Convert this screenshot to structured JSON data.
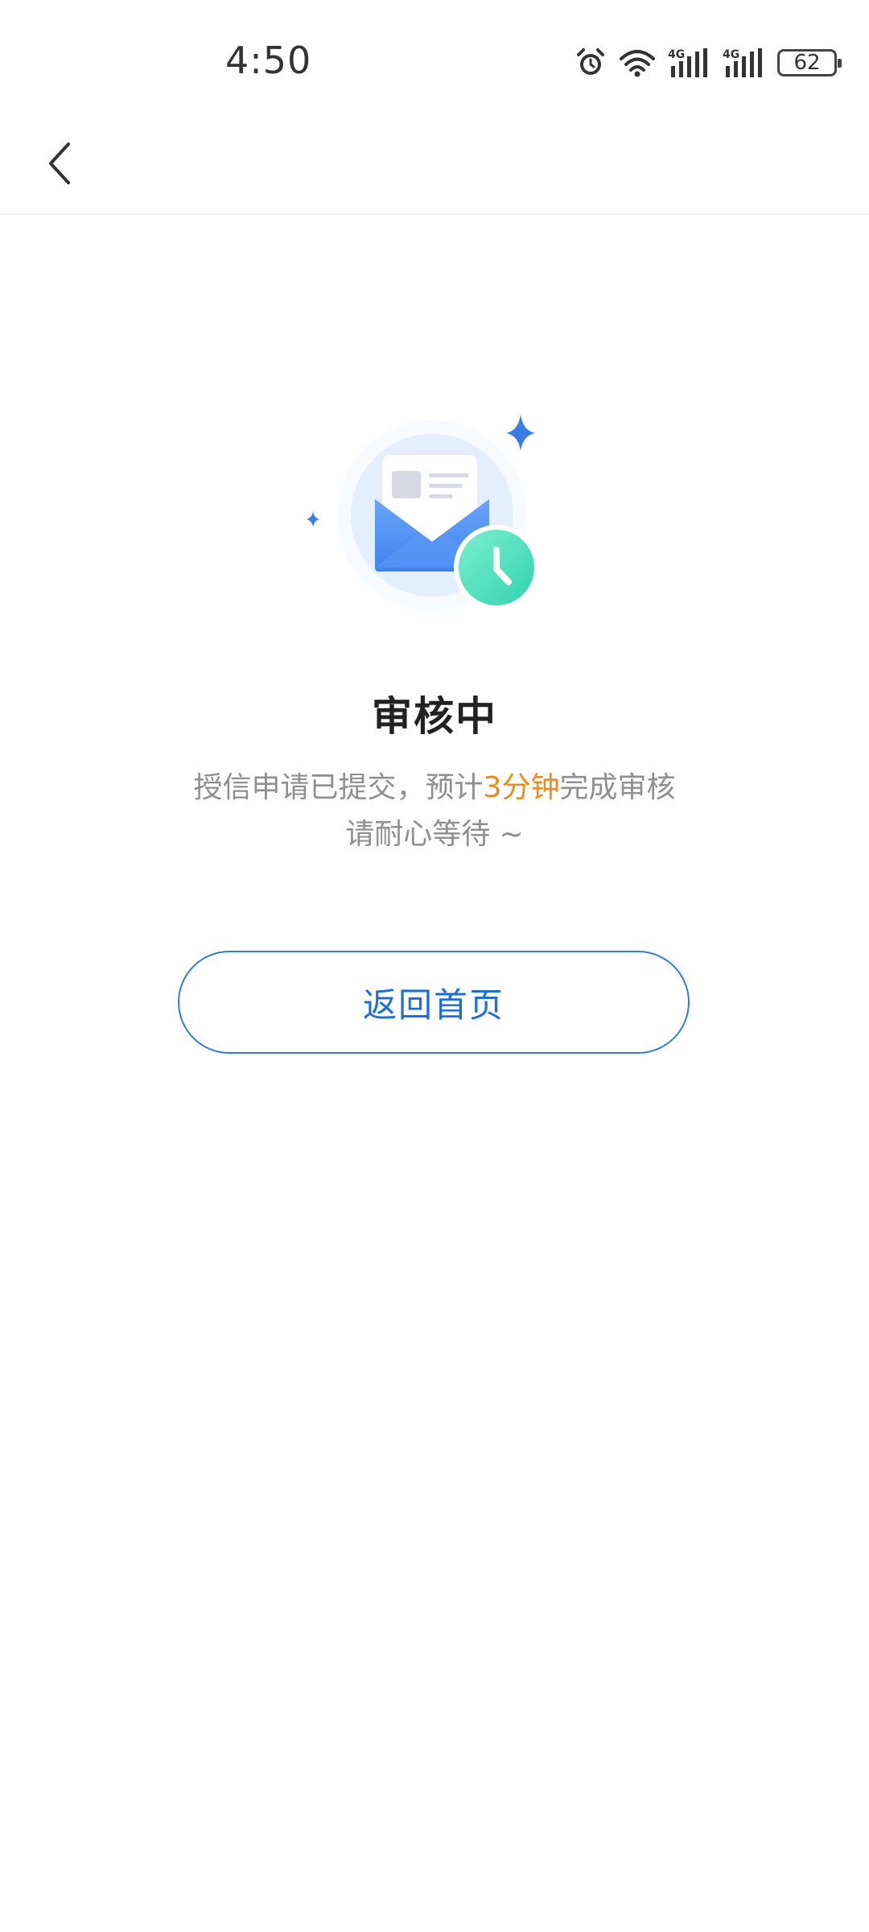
{
  "status_bar": {
    "time": "4:50",
    "battery": "62",
    "icons": [
      "alarm-icon",
      "wifi-icon",
      "signal-4g-icon",
      "signal-4g-icon",
      "battery-icon"
    ]
  },
  "nav": {
    "back_icon": "chevron-left-icon"
  },
  "main": {
    "illustration": "envelope-clock-icon",
    "title": "审核中",
    "desc_prefix": "授信申请已提交，预计",
    "desc_highlight": "3分钟",
    "desc_suffix": "完成审核",
    "desc_line2": "请耐心等待 ~",
    "highlight_color": "#ef8a1a",
    "home_button_label": "返回首页"
  }
}
